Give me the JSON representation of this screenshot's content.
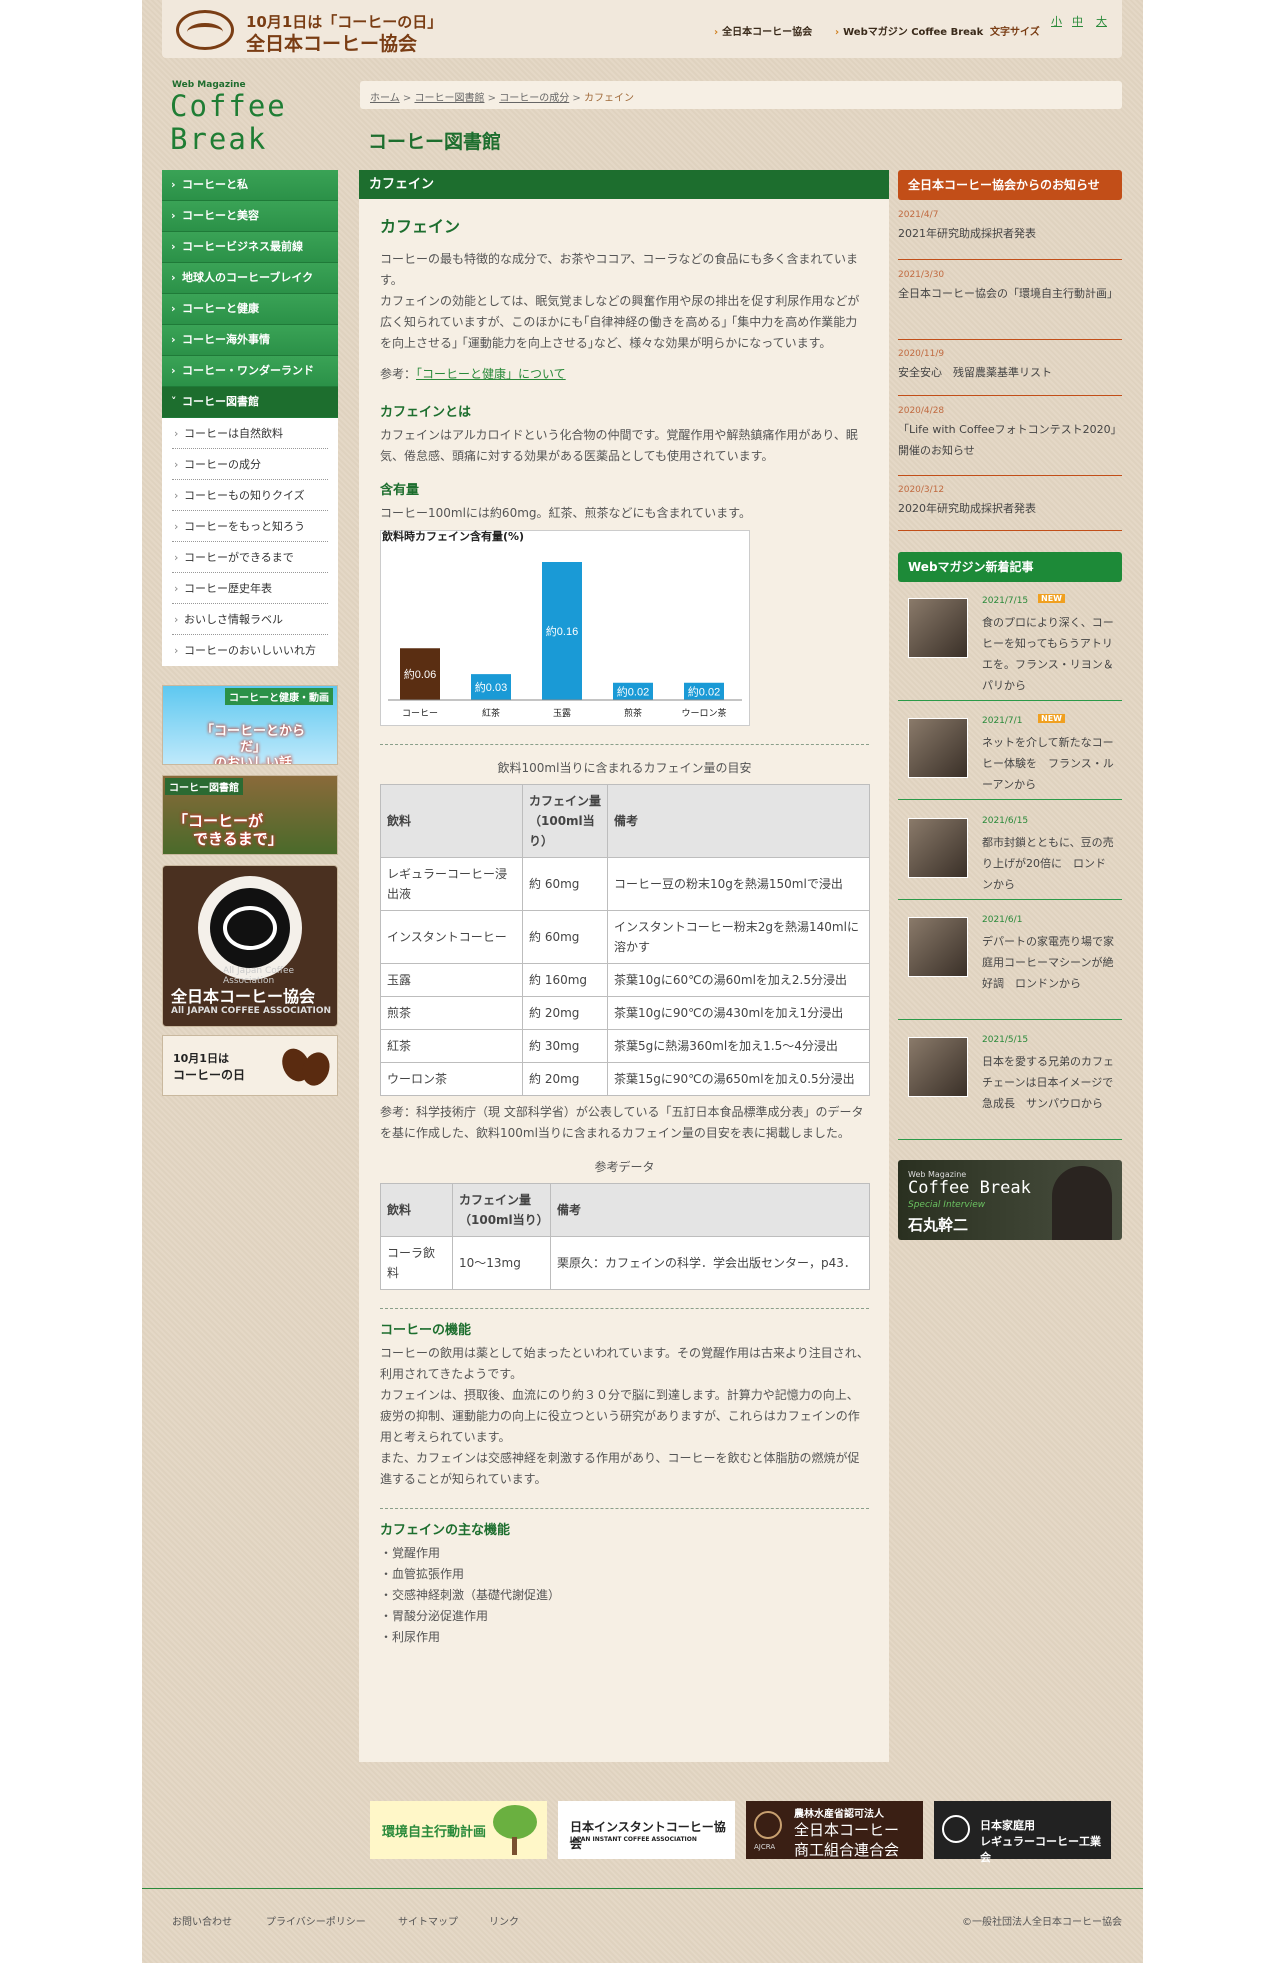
{
  "header": {
    "logo_line1": "10月1日は「コーヒーの日」",
    "logo_line2": "全日本コーヒー協会",
    "links": [
      "全日本コーヒー協会",
      "Webマガジン Coffee Break"
    ],
    "font_size_label": "文字サイズ",
    "font_sizes": [
      "小",
      "中",
      "大"
    ]
  },
  "webmag": {
    "small": "Web Magazine",
    "line1": "Coffee",
    "line2": "Break"
  },
  "breadcrumb": {
    "items": [
      "ホーム",
      "コーヒー図書館",
      "コーヒーの成分"
    ],
    "sep": ">",
    "current": "カフェイン"
  },
  "page_title": "コーヒー図書館",
  "nav": {
    "items": [
      "コーヒーと私",
      "コーヒーと美容",
      "コーヒービジネス最前線",
      "地球人のコーヒーブレイク",
      "コーヒーと健康",
      "コーヒー海外事情",
      "コーヒー・ワンダーランド",
      "コーヒー図書館"
    ],
    "sub_items": [
      "コーヒーは自然飲料",
      "コーヒーの成分",
      "コーヒーもの知りクイズ",
      "コーヒーをもっと知ろう",
      "コーヒーができるまで",
      "コーヒー歴史年表",
      "おいしさ情報ラベル",
      "コーヒーのおいしいいれ方"
    ]
  },
  "banners": {
    "b1_title": "コーヒーと健康・動画",
    "b1_line1": "「コーヒーとからだ」",
    "b1_line2": "のおいしい話",
    "b2_title": "コーヒー図書館",
    "b2_line1": "「コーヒーが",
    "b2_line2": "できるまで」",
    "b3_sub": "All Japan Coffee Association",
    "b3_title": "全日本コーヒー協会",
    "b3_en": "All JAPAN COFFEE ASSOCIATION",
    "b4_line1": "10月1日は",
    "b4_line2": "コーヒーの日"
  },
  "main": {
    "header": "カフェイン",
    "title": "カフェイン",
    "intro": "コーヒーの最も特徴的な成分で、お茶やココア、コーラなどの食品にも多く含まれています。",
    "intro2": "カフェインの効能としては、眠気覚ましなどの興奮作用や尿の排出を促す利尿作用などが広く知られていますが、このほかにも｢自律神経の働きを高める｣ ｢集中力を高め作業能力を向上させる｣ ｢運動能力を向上させる｣など、様々な効果が明らかになっています。",
    "ref_label": "参考：",
    "ref_link": "「コーヒーと健康」について",
    "h_about": "カフェインとは",
    "about": "カフェインはアルカロイドという化合物の仲間です。覚醒作用や解熱鎮痛作用があり、眠気、倦怠感、頭痛に対する効果がある医薬品としても使用されています。",
    "h_content": "含有量",
    "content": "コーヒー100mlには約60mg。紅茶、煎茶などにも含まれています。",
    "table_caption": "飲料100ml当りに含まれるカフェイン量の目安",
    "table_headers": [
      "飲料",
      "カフェイン量（100ml当り）",
      "備考"
    ],
    "table_rows": [
      [
        "レギュラーコーヒー浸出液",
        "約 60mg",
        "コーヒー豆の粉末10gを熱湯150mlで浸出"
      ],
      [
        "インスタントコーヒー",
        "約 60mg",
        "インスタントコーヒー粉末2gを熱湯140mlに溶かす"
      ],
      [
        "玉露",
        "約 160mg",
        "茶葉10gに60℃の湯60mlを加え2.5分浸出"
      ],
      [
        "煎茶",
        "約 20mg",
        "茶葉10gに90℃の湯430mlを加え1分浸出"
      ],
      [
        "紅茶",
        "約 30mg",
        "茶葉5gに熱湯360mlを加え1.5～4分浸出"
      ],
      [
        "ウーロン茶",
        "約 20mg",
        "茶葉15gに90℃の湯650mlを加え0.5分浸出"
      ]
    ],
    "table_note": "参考：科学技術庁（現 文部科学省）が公表している「五訂日本食品標準成分表」のデータを基に作成した、飲料100ml当りに含まれるカフェイン量の目安を表に掲載しました。",
    "ref_caption": "参考データ",
    "ref_headers": [
      "飲料",
      "カフェイン量（100ml当り）",
      "備考"
    ],
    "ref_rows": [
      [
        "コーラ飲料",
        "10～13mg",
        "栗原久：カフェインの科学．学会出版センター，p43．"
      ]
    ],
    "h_function": "コーヒーの機能",
    "function1": "コーヒーの飲用は薬として始まったといわれています。その覚醒作用は古来より注目され、利用されてきたようです。",
    "function2": "カフェインは、摂取後、血流にのり約３０分で脳に到達します。計算力や記憶力の向上、疲労の抑制、運動能力の向上に役立つという研究がありますが、これらはカフェインの作用と考えられています。",
    "function3": "また、カフェインは交感神経を刺激する作用があり、コーヒーを飲むと体脂肪の燃焼が促進することが知られています。",
    "h_main": "カフェインの主な機能",
    "main_functions": [
      "・覚醒作用",
      "・血管拡張作用",
      "・交感神経刺激（基礎代謝促進）",
      "・胃酸分泌促進作用",
      "・利尿作用"
    ]
  },
  "chart_data": {
    "type": "bar",
    "title": "飲料時カフェイン含有量(%)",
    "categories": [
      "コーヒー",
      "紅茶",
      "玉露",
      "煎茶",
      "ウーロン茶"
    ],
    "values": [
      0.06,
      0.03,
      0.16,
      0.02,
      0.02
    ],
    "labels": [
      "約0.06",
      "約0.03",
      "約0.16",
      "約0.02",
      "約0.02"
    ],
    "colors": [
      "#5a2e12",
      "#1a9ad6",
      "#1a9ad6",
      "#1a9ad6",
      "#1a9ad6"
    ],
    "ylim": [
      0,
      0.16
    ],
    "grid": false
  },
  "news": {
    "header": "全日本コーヒー協会からのお知らせ",
    "items": [
      {
        "date": "2021/4/7",
        "title": "2021年研究助成採択者発表"
      },
      {
        "date": "2021/3/30",
        "title": "全日本コーヒー協会の「環境自主行動計画」"
      },
      {
        "date": "2020/11/9",
        "title": "安全安心　残留農薬基準リスト"
      },
      {
        "date": "2020/4/28",
        "title": "「Life with Coffeeフォトコンテスト2020」開催のお知らせ"
      },
      {
        "date": "2020/3/12",
        "title": "2020年研究助成採択者発表"
      }
    ]
  },
  "webmag_news": {
    "header": "Webマガジン新着記事",
    "new_badge": "NEW",
    "items": [
      {
        "date": "2021/7/15",
        "new": true,
        "title": "食のプロにより深く、コーヒーを知ってもらうアトリエを。フランス・リヨン＆パリから"
      },
      {
        "date": "2021/7/1",
        "new": true,
        "title": "ネットを介して新たなコーヒー体験を　フランス・ルーアンから"
      },
      {
        "date": "2021/6/15",
        "new": false,
        "title": "都市封鎖とともに、豆の売り上げが20倍に　ロンドンから"
      },
      {
        "date": "2021/6/1",
        "new": false,
        "title": "デパートの家電売り場で家庭用コーヒーマシーンが絶好調　ロンドンから"
      },
      {
        "date": "2021/5/15",
        "new": false,
        "title": "日本を愛する兄弟のカフェチェーンは日本イメージで急成長　サンパウロから"
      }
    ]
  },
  "interview": {
    "small": "Web Magazine",
    "title": "Coffee Break",
    "sub": "Special Interview",
    "name": "石丸幹二"
  },
  "footer_banners": {
    "b1": "環境自主行動計画",
    "b2": "日本インスタントコーヒー協会",
    "b2_en": "JAPAN INSTANT COFFEE ASSOCIATION",
    "b3_line1": "農林水産省認可法人",
    "b3_line2": "全日本コーヒー",
    "b3_line3": "商工組合連合会",
    "b3_mark": "AJCRA",
    "b4_line1": "日本家庭用",
    "b4_line2": "レギュラーコーヒー工業会"
  },
  "footer": {
    "links": [
      "お問い合わせ",
      "プライバシーポリシー",
      "サイトマップ",
      "リンク"
    ],
    "copyright": "©一般社団法人全日本コーヒー協会"
  }
}
